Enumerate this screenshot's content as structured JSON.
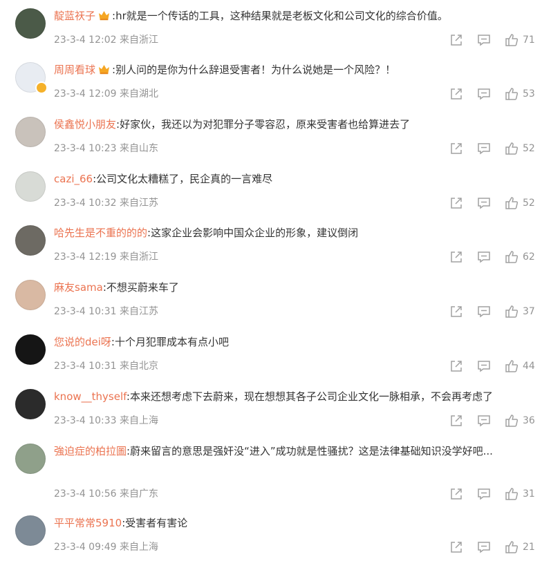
{
  "comments": [
    {
      "user": "靛蓝祆子",
      "vip": true,
      "verified": false,
      "sep": ":",
      "text": "hr就是一个传话的工具，这种结果就是老板文化和公司文化的综合价值。",
      "time": "23-3-4 12:02",
      "location": "来自浙江",
      "likes": "71",
      "avatar_color": "#4b5a48"
    },
    {
      "user": "周周看球",
      "vip": true,
      "verified": true,
      "sep": ":",
      "text": "别人问的是你为什么辞退受害者！为什么说她是一个风险？！",
      "time": "23-3-4 12:09",
      "location": "来自湖北",
      "likes": "53",
      "avatar_color": "#e8ecf2"
    },
    {
      "user": "侯鑫悦小朋友",
      "vip": false,
      "verified": false,
      "sep": ":",
      "text": "好家伙，我还以为对犯罪分子零容忍，原来受害者也给算进去了",
      "time": "23-3-4 10:23",
      "location": "来自山东",
      "likes": "52",
      "avatar_color": "#c9c2bb"
    },
    {
      "user": "cazi_66",
      "vip": false,
      "verified": false,
      "sep": ":",
      "text": "公司文化太糟糕了，民企真的一言难尽",
      "time": "23-3-4 10:32",
      "location": "来自江苏",
      "likes": "52",
      "avatar_color": "#d8dbd6"
    },
    {
      "user": "哈先生是不重的的的",
      "vip": false,
      "verified": false,
      "sep": ":",
      "text": "这家企业会影响中国众企业的形象，建议倒闭",
      "time": "23-3-4 12:19",
      "location": "来自浙江",
      "likes": "62",
      "avatar_color": "#6d6a63"
    },
    {
      "user": "麻友sama",
      "vip": false,
      "verified": false,
      "sep": ":",
      "text": "不想买蔚来车了",
      "time": "23-3-4 10:31",
      "location": "来自江苏",
      "likes": "37",
      "avatar_color": "#d9b9a3"
    },
    {
      "user": "您说的dei呀",
      "vip": false,
      "verified": false,
      "sep": ":",
      "text": "十个月犯罪成本有点小吧",
      "time": "23-3-4 10:31",
      "location": "来自北京",
      "likes": "44",
      "avatar_color": "#151515"
    },
    {
      "user": "know__thyself",
      "vip": false,
      "verified": false,
      "sep": ":",
      "text": "本来还想考虑下去蔚来，现在想想其各子公司企业文化一脉相承，不会再考虑了",
      "time": "23-3-4 10:33",
      "location": "来自上海",
      "likes": "36",
      "avatar_color": "#2b2b2b"
    },
    {
      "user": "強迫症的柏拉圖",
      "vip": false,
      "verified": false,
      "sep": ":",
      "text": "蔚来留言的意思是强奸没“进入”成功就是性骚扰？这是法律基础知识没学好吧...",
      "time": "23-3-4 10:56",
      "location": "来自广东",
      "likes": "31",
      "avatar_color": "#8fa08a"
    },
    {
      "user": "平平常常5910",
      "vip": false,
      "verified": false,
      "sep": ":",
      "text": "受害者有害论",
      "time": "23-3-4 09:49",
      "location": "来自上海",
      "likes": "21",
      "avatar_color": "#7d8a96"
    }
  ],
  "icons": {
    "share": "share-icon",
    "reply": "comment-icon",
    "like": "thumbs-up-icon",
    "vip": "crown-icon",
    "verified": "verified-badge-icon"
  },
  "colors": {
    "username": "#eb7350",
    "text": "#333333",
    "meta": "#939393",
    "icon": "#a0a0a0",
    "vip_crown": "#f5a623"
  }
}
